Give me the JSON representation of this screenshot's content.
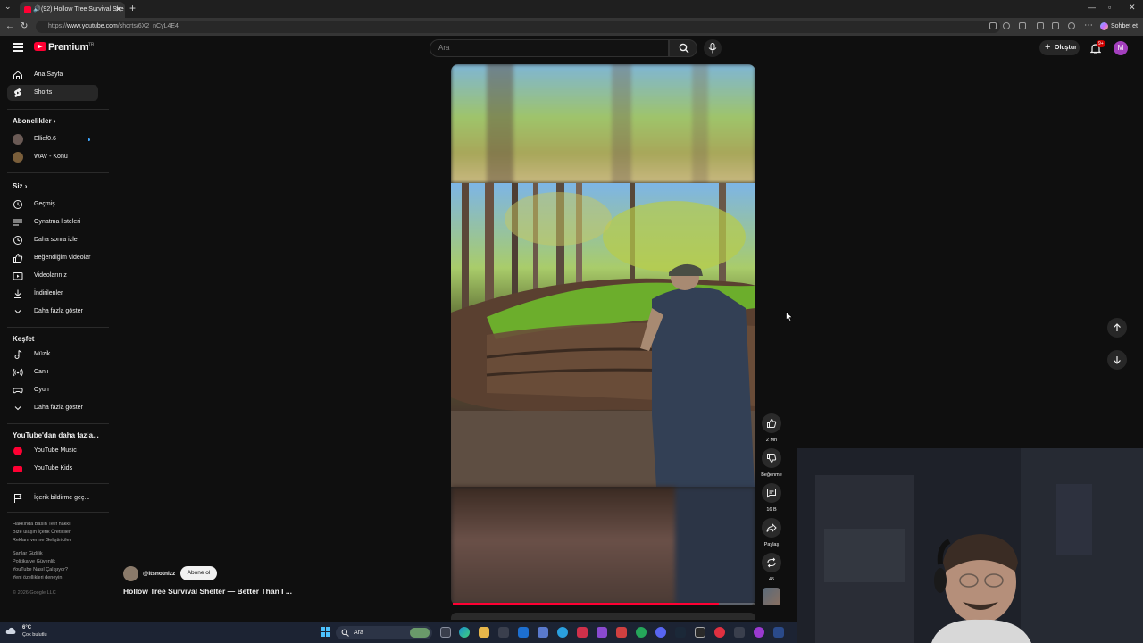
{
  "browser": {
    "tab_title": "(92) Hollow Tree Survival She",
    "url_prefix": "https://",
    "url_host": "www.youtube.com",
    "url_path": "/shorts/6X2_nCyL4E4",
    "sohbet_label": "Sohbet et"
  },
  "header": {
    "logo_text": "Premium",
    "logo_sup": "TR",
    "search_placeholder": "Ara",
    "create_label": "Oluştur",
    "notif_badge": "9+",
    "avatar_letter": "M"
  },
  "sidebar": {
    "home": "Ana Sayfa",
    "shorts": "Shorts",
    "subs_header": "Abonelikler",
    "subs": [
      "Ellief0.6",
      "WAV - Konu"
    ],
    "you_header": "Siz",
    "you_items": [
      "Geçmiş",
      "Oynatma listeleri",
      "Daha sonra izle",
      "Beğendiğim videolar",
      "Videolarınız",
      "İndirilenler",
      "Daha fazla göster"
    ],
    "explore_header": "Keşfet",
    "explore_items": [
      "Müzik",
      "Canlı",
      "Oyun",
      "Daha fazla göster"
    ],
    "more_header": "YouTube'dan daha fazla...",
    "more_items": [
      "YouTube Music",
      "YouTube Kids"
    ],
    "report": "İçerik bildirme geç...",
    "footer1": "Hakkında  Basın  Telif hakkı",
    "footer2": "Bize ulaşın  İçerik Üreticiler",
    "footer3": "Reklam verme  Geliştiriciler",
    "footer4": "Şartlar  Gizlilik",
    "footer5": "Politika ve Güvenlik",
    "footer6": "YouTube Nasıl Çalışıyor?",
    "footer7": "Yeni özellikleri deneyin",
    "copyright": "© 2026 Google LLC"
  },
  "short": {
    "channel": "@itsnotnizz",
    "subscribe": "Abone ol",
    "title": "Hollow Tree Survival Shelter — Better Than I ...",
    "progress": 0.88,
    "likes": "2 Mn",
    "dislike_label": "Beğenme",
    "comments": "16 B",
    "share_label": "Paylaş",
    "remix_count": "45"
  },
  "taskbar": {
    "temp": "6°C",
    "weather": "Çok bulutlu",
    "search": "Ara"
  }
}
